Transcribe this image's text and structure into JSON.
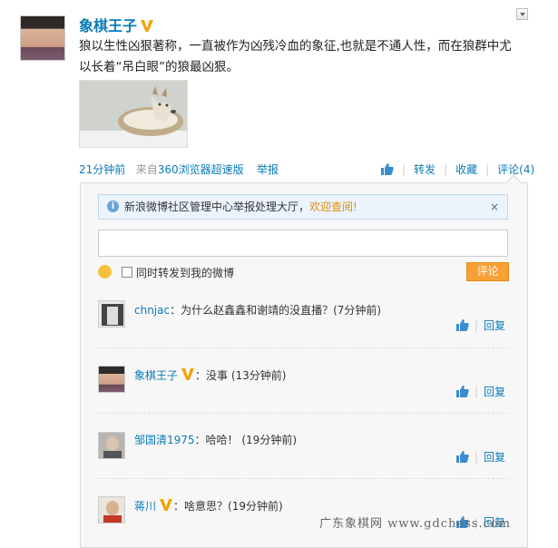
{
  "post": {
    "author": "象棋王子",
    "text_line1": "狼以生性凶狠著称，一直被作为凶残冷血的象征,也就是不通人性，而在狼群中尤",
    "text_line2": "以长着“吊白眼”的狼最凶狠。",
    "time": "21分钟前",
    "source_prefix": "来自",
    "source": "360浏览器超速版",
    "report": "举报"
  },
  "actions": {
    "forward": "转发",
    "favorite": "收藏",
    "comments": "评论(4)"
  },
  "panel": {
    "notice_text": "新浪微博社区管理中心举报处理大厅，",
    "notice_link": "欢迎查阅!",
    "close": "×",
    "input_value": "",
    "checkbox_label": "同时转发到我的微博",
    "submit_label": "评论"
  },
  "comments": [
    {
      "name": "chnjac",
      "text": "：为什么赵鑫鑫和谢靖的没直播？(7分钟前)",
      "reply": "回复",
      "verified": false
    },
    {
      "name": "象棋王子",
      "text": "：没事 (13分钟前)",
      "reply": "回复",
      "verified": true
    },
    {
      "name": "邹国清1975",
      "text": "：哈哈！ (19分钟前)",
      "reply": "回复",
      "verified": false
    },
    {
      "name": "蒋川",
      "text": "：啥意思？(19分钟前)",
      "reply": "回复",
      "verified": true
    }
  ],
  "watermark": "广东象棋网 www.gdchess.com",
  "colors": {
    "link": "#0a7bb8",
    "accent": "#f9a034",
    "verified": "#f0a30a"
  }
}
